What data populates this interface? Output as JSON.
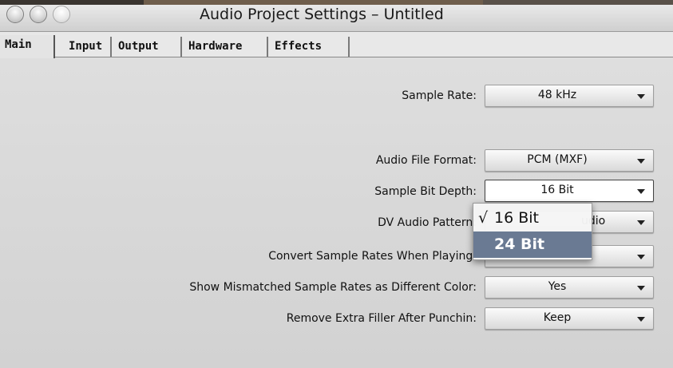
{
  "window": {
    "title": "Audio Project Settings – Untitled"
  },
  "tabs": [
    {
      "label": "Main",
      "active": true
    },
    {
      "label": "Input",
      "active": false
    },
    {
      "label": "Output",
      "active": false
    },
    {
      "label": "Hardware",
      "active": false
    },
    {
      "label": "Effects",
      "active": false
    }
  ],
  "settings": {
    "sample_rate": {
      "label": "Sample Rate:",
      "value": "48 kHz"
    },
    "audio_file_format": {
      "label": "Audio File Format:",
      "value": "PCM  (MXF)"
    },
    "sample_bit_depth": {
      "label": "Sample Bit Depth:",
      "value": "16 Bit"
    },
    "dv_audio_pattern": {
      "label": "DV Audio Pattern:",
      "value": "udio"
    },
    "convert_sample_rates": {
      "label": "Convert Sample Rates When Playing:",
      "value": ""
    },
    "show_mismatched": {
      "label": "Show Mismatched Sample Rates as Different Color:",
      "value": "Yes"
    },
    "remove_filler": {
      "label": "Remove Extra Filler After Punchin:",
      "value": "Keep"
    }
  },
  "bit_depth_menu": {
    "check_mark": "√",
    "items": [
      {
        "label": "16 Bit",
        "checked": true,
        "highlighted": false
      },
      {
        "label": "24 Bit",
        "checked": false,
        "highlighted": true
      }
    ]
  },
  "colors": {
    "menu_highlight": "#6a7a93",
    "panel_background": "#d8d8d8"
  }
}
